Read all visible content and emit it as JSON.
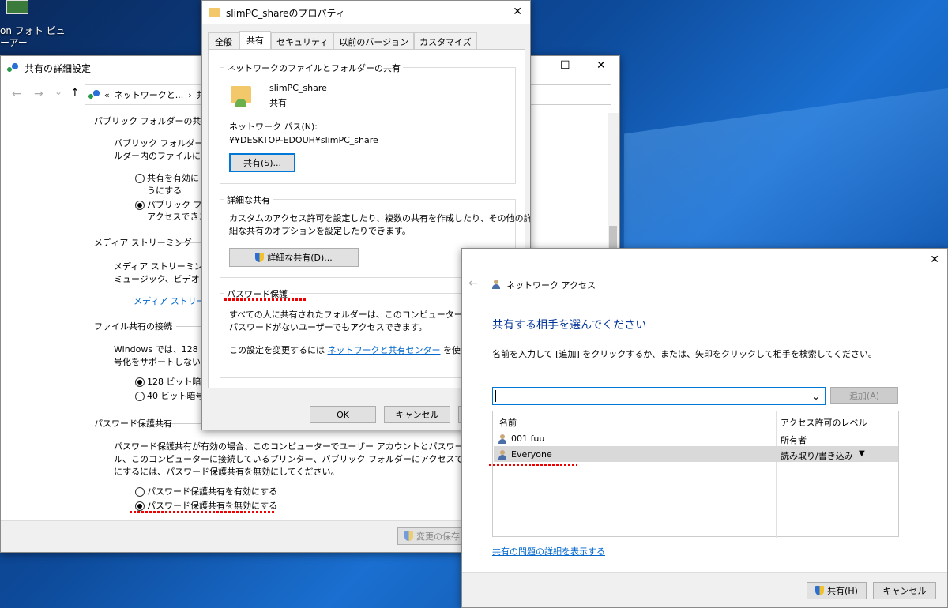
{
  "desktop": {
    "icon_label_1": "on フォト ビュ",
    "icon_label_2": "ーアー"
  },
  "adv": {
    "title": "共有の詳細設定",
    "breadcrumb_1": "ネットワークと...",
    "breadcrumb_sep": "›",
    "breadcrumb_2": "共",
    "back_chevron": "«",
    "public_heading": "パブリック フォルダーの共有",
    "public_text_1": "パブリック フォルダーの共",
    "public_text_2": "ルダー内のファイルにアク",
    "public_opt1_a": "共有を有効に",
    "public_opt1_b": "うにする",
    "public_opt2_a": "パブリック フォル",
    "public_opt2_b": "アクセスできま",
    "media_heading": "メディア ストリーミング",
    "media_text_1": "メディア ストリーミングが有",
    "media_text_2": "ミュージック、ビデオにアク",
    "media_link": "メディア ストリーミ",
    "fileconn_heading": "ファイル共有の接続",
    "fileconn_text_1": "Windows では、128 ビ",
    "fileconn_text_2": "号化をサポートしないか",
    "fileconn_opt1": "128 ビット暗号",
    "fileconn_opt2": "40 ビット暗号イ",
    "pwd_heading": "パスワード保護共有",
    "pwd_text_1": "パスワード保護共有が有効の場合、このコンピューターでユーザー アカウントとパスワードを持つ人の",
    "pwd_text_2": "ル、このコンピューターに接続しているプリンター、パブリック フォルダーにアクセスできます。他の人が",
    "pwd_text_3": "にするには、パスワード保護共有を無効にしてください。",
    "pwd_opt1": "パスワード保護共有を有効にする",
    "pwd_opt2": "パスワード保護共有を無効にする",
    "save_label": "変更の保存"
  },
  "props": {
    "title": "slimPC_shareのプロパティ",
    "tabs": [
      "全般",
      "共有",
      "セキュリティ",
      "以前のバージョン",
      "カスタマイズ"
    ],
    "group1_label": "ネットワークのファイルとフォルダーの共有",
    "folder_name": "slimPC_share",
    "folder_status": "共有",
    "netpath_label": "ネットワーク パス(N):",
    "netpath_value": "¥¥DESKTOP-EDOUH¥slimPC_share",
    "share_btn": "共有(S)...",
    "group2_label": "詳細な共有",
    "adv_text_1": "カスタムのアクセス許可を設定したり、複数の共有を作成したり、その他の詳",
    "adv_text_2": "細な共有のオプションを設定したりできます。",
    "adv_btn": "詳細な共有(D)...",
    "group3_label": "パスワード保護",
    "pwd_text_1": "すべての人に共有されたフォルダーは、このコンピューターにユーザー",
    "pwd_text_2": "パスワードがないユーザーでもアクセスできます。",
    "pwd_text_3": "この設定を変更するには ",
    "pwd_link": "ネットワークと共有センター",
    "pwd_text_4": " を使用してく",
    "ok": "OK",
    "cancel": "キャンセル"
  },
  "netaccess": {
    "title": "ネットワーク アクセス",
    "heading": "共有する相手を選んでください",
    "instruction": "名前を入力して [追加] をクリックするか、または、矢印をクリックして相手を検索してください。",
    "input_value": "",
    "add_btn": "追加(A)",
    "col_name": "名前",
    "col_level": "アクセス許可のレベル",
    "rows": [
      {
        "name": "001 fuu",
        "level": "所有者"
      },
      {
        "name": "Everyone",
        "level": "読み取り/書き込み"
      }
    ],
    "trouble_link": "共有の問題の詳細を表示する",
    "share_btn": "共有(H)",
    "cancel_btn": "キャンセル"
  },
  "glyphs": {
    "close": "✕",
    "maximize": "☐",
    "minimize": "—",
    "back_arrow": "←",
    "fwd_arrow": "→",
    "up_arrow": "↑",
    "dropdown": "⌄",
    "triangle_down": "▼"
  }
}
